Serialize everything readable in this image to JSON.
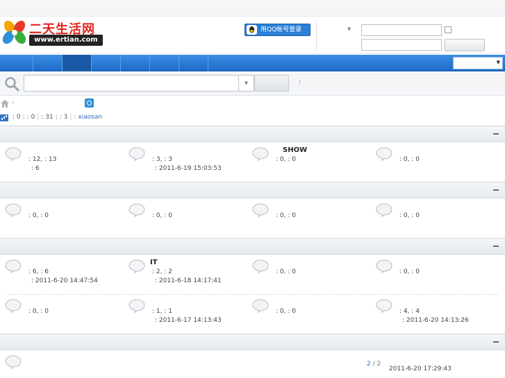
{
  "header": {
    "logo_cn": "二天生活网",
    "logo_url": "www.ertian.com",
    "qq_login_label": "用QQ帐号登录"
  },
  "search": {
    "hot_label": ":"
  },
  "stats": {
    "today": ": 0",
    "yesterday": ": 0",
    "posts": ": 31",
    "members": ": 3",
    "newest_member": ": xiaosan"
  },
  "categories": [
    {
      "rows": [
        [
          {
            "title": "",
            "stats": ": 12, : 13",
            "last": ": 6"
          },
          {
            "title": "",
            "stats": ": 3, : 3",
            "last": ": 2011-6-19 15:03:53"
          },
          {
            "title": "SHOW",
            "stats": ": 0, : 0",
            "last": ""
          },
          {
            "title": "",
            "stats": ": 0, : 0",
            "last": ""
          }
        ]
      ]
    },
    {
      "rows": [
        [
          {
            "title": "",
            "stats": ": 0, : 0",
            "last": ""
          },
          {
            "title": "",
            "stats": ": 0, : 0",
            "last": ""
          },
          {
            "title": "",
            "stats": ": 0, : 0",
            "last": ""
          },
          {
            "title": "",
            "stats": ": 0, : 0",
            "last": ""
          }
        ]
      ]
    },
    {
      "rows": [
        [
          {
            "title": "",
            "stats": ": 6, : 6",
            "last": ": 2011-6-20 14:47:54"
          },
          {
            "title": "IT",
            "stats": ": 2, : 2",
            "last": ": 2011-6-18 14:17:41"
          },
          {
            "title": "",
            "stats": ": 0, : 0",
            "last": ""
          },
          {
            "title": "",
            "stats": ": 0, : 0",
            "last": ""
          }
        ],
        [
          {
            "title": "",
            "stats": ": 0, : 0",
            "last": ""
          },
          {
            "title": "",
            "stats": ": 1, : 1",
            "last": ": 2011-6-17 14:13:43"
          },
          {
            "title": "",
            "stats": ": 0, : 0",
            "last": ""
          },
          {
            "title": "",
            "stats": ": 4, : 4",
            "last": ": 2011-6-20 14:13:26"
          }
        ]
      ]
    }
  ],
  "bottom": {
    "page_current": "2",
    "page_total": "/ 2",
    "last_post": "2011-6-20 17:29:43"
  }
}
